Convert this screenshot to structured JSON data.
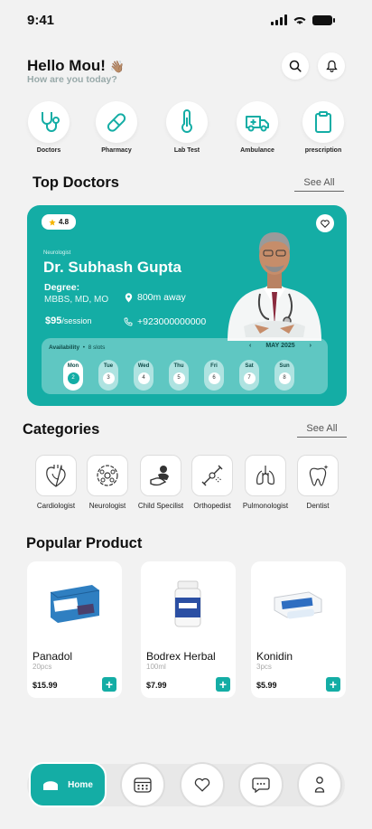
{
  "status": {
    "time": "9:41"
  },
  "header": {
    "greeting": "Hello Mou!",
    "emoji": "👋🏽",
    "subtitle": "How are you today?"
  },
  "services": [
    {
      "label": "Doctors",
      "icon": "stethoscope-icon"
    },
    {
      "label": "Pharmacy",
      "icon": "pill-icon"
    },
    {
      "label": "Lab Test",
      "icon": "thermometer-icon"
    },
    {
      "label": "Ambulance",
      "icon": "ambulance-icon"
    },
    {
      "label": "prescription",
      "icon": "clipboard-icon"
    }
  ],
  "top_doctors": {
    "title": "Top Doctors",
    "see_all": "See All",
    "card": {
      "rating": "4.8",
      "specialty": "Neurologist",
      "name": "Dr. Subhash Gupta",
      "degree_label": "Degree:",
      "degree_value": "MBBS, MD, MO",
      "distance": "800m away",
      "fee": "$95",
      "fee_unit": "/session",
      "phone": "+923000000000",
      "availability_label": "Availability",
      "slots": "8 slots",
      "month": "MAY 2025",
      "days": [
        {
          "name": "Mon",
          "num": "2",
          "active": true
        },
        {
          "name": "Tue",
          "num": "3"
        },
        {
          "name": "Wed",
          "num": "4"
        },
        {
          "name": "Thu",
          "num": "5"
        },
        {
          "name": "Fri",
          "num": "6"
        },
        {
          "name": "Sat",
          "num": "7"
        },
        {
          "name": "Sun",
          "num": "8"
        }
      ]
    }
  },
  "categories": {
    "title": "Categories",
    "see_all": "See All",
    "items": [
      {
        "label": "Cardiologist",
        "icon": "heart-organ-icon"
      },
      {
        "label": "Neurologist",
        "icon": "brain-icon"
      },
      {
        "label": "Child Specilist",
        "icon": "child-care-icon"
      },
      {
        "label": "Orthopedist",
        "icon": "bone-joint-icon"
      },
      {
        "label": "Pulmonologist",
        "icon": "lungs-icon"
      },
      {
        "label": "Dentist",
        "icon": "tooth-icon"
      }
    ]
  },
  "popular": {
    "title": "Popular Product",
    "items": [
      {
        "name": "Panadol",
        "qty": "20pcs",
        "price": "$15.99"
      },
      {
        "name": "Bodrex Herbal",
        "qty": "100ml",
        "price": "$7.99"
      },
      {
        "name": "Konidin",
        "qty": "3pcs",
        "price": "$5.99"
      }
    ],
    "add_label": "+"
  },
  "nav": {
    "home": "Home"
  },
  "colors": {
    "accent": "#14ada5",
    "background": "#f2f2f2"
  }
}
